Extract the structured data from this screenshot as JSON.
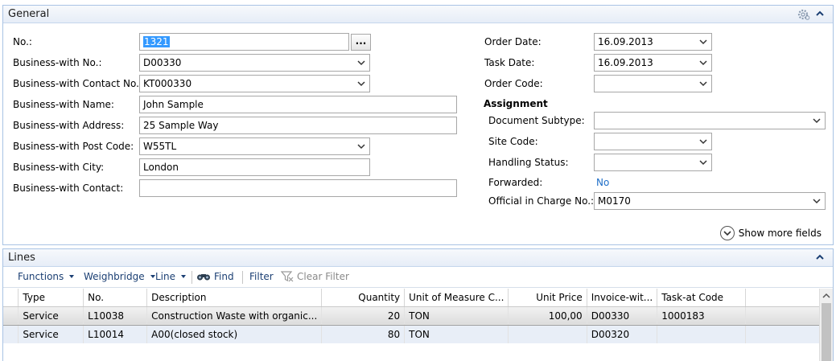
{
  "general": {
    "title": "General",
    "left_fields": [
      {
        "label": "No.:",
        "value": "1321"
      },
      {
        "label": "Business-with No.:",
        "value": "D00330"
      },
      {
        "label": "Business-with Contact No.:",
        "value": "KT000330"
      },
      {
        "label": "Business-with Name:",
        "value": "John Sample"
      },
      {
        "label": "Business-with Address:",
        "value": "25 Sample Way"
      },
      {
        "label": "Business-with Post Code:",
        "value": "W55TL"
      },
      {
        "label": "Business-with City:",
        "value": "London"
      },
      {
        "label": "Business-with Contact:",
        "value": ""
      }
    ],
    "ellipsis": "...",
    "right_fields": [
      {
        "label": "Order Date:",
        "value": "16.09.2013"
      },
      {
        "label": "Task Date:",
        "value": "16.09.2013"
      },
      {
        "label": "Order Code:",
        "value": ""
      }
    ],
    "assignment": {
      "heading": "Assignment",
      "document_subtype": {
        "label": "Document Subtype:",
        "value": ""
      },
      "site_code": {
        "label": "Site Code:",
        "value": ""
      },
      "handling_status": {
        "label": "Handling Status:",
        "value": ""
      },
      "forwarded": {
        "label": "Forwarded:",
        "value": "No"
      },
      "official": {
        "label": "Official in Charge No.:",
        "value": "M0170"
      }
    },
    "show_more": "Show more fields"
  },
  "lines": {
    "title": "Lines",
    "toolbar": {
      "functions": "Functions",
      "weighbridge": "Weighbridge",
      "line": "Line",
      "find": "Find",
      "filter": "Filter",
      "clear_filter": "Clear Filter"
    },
    "columns": [
      "Type",
      "No.",
      "Description",
      "Quantity",
      "Unit of Measure C...",
      "Unit Price",
      "Invoice-wit...",
      "Task-at Code"
    ],
    "rows": [
      {
        "type": "Service",
        "no": "L10038",
        "description": "Construction Waste with organic...",
        "quantity": "20",
        "uom": "TON",
        "unit_price": "100,00",
        "invoice": "D00330",
        "task": "1000183"
      },
      {
        "type": "Service",
        "no": "L10014",
        "description": "A00(closed stock)",
        "quantity": "80",
        "uom": "TON",
        "unit_price": "",
        "invoice": "D00320",
        "task": ""
      }
    ]
  }
}
